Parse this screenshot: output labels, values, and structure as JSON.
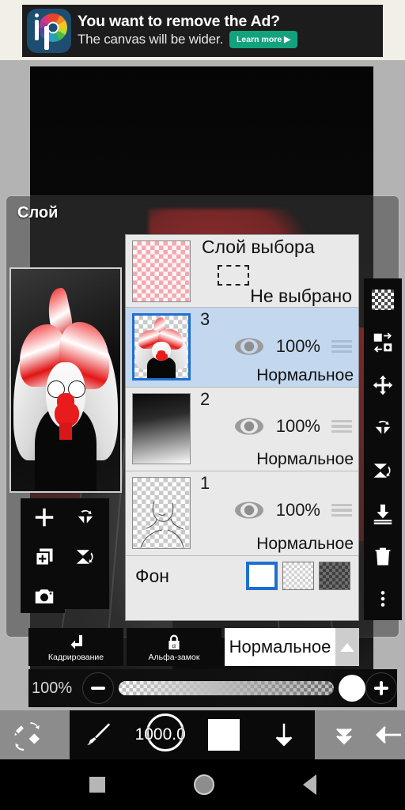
{
  "ad": {
    "headline": "You want to remove the Ad?",
    "subline": "The canvas will be wider.",
    "cta": "Learn more ▶",
    "logo_alt": "ibis Paint X",
    "cta_color": "#12a37d"
  },
  "panel": {
    "title": "Слой",
    "selection_row": {
      "title": "Слой выбора",
      "state": "Не выбрано"
    },
    "layers": [
      {
        "number": "3",
        "opacity": "100%",
        "blend": "Нормальное",
        "selected": true,
        "thumb": "artwork-character"
      },
      {
        "number": "2",
        "opacity": "100%",
        "blend": "Нормальное",
        "selected": false,
        "thumb": "black-white-gradient"
      },
      {
        "number": "1",
        "opacity": "100%",
        "blend": "Нормальное",
        "selected": false,
        "thumb": "sketch-lines"
      }
    ],
    "background": {
      "label": "Фон",
      "swatches": [
        "white",
        "light-checker",
        "dark-checker"
      ],
      "selected_index": 0,
      "selected_color": "#1f6fd0"
    }
  },
  "left_tools": [
    {
      "name": "add-layer-button",
      "icon": "plus-icon"
    },
    {
      "name": "rotate-flip-horizontal-button",
      "icon": "flip-horizontal-rotate-icon"
    },
    {
      "name": "duplicate-layer-button",
      "icon": "copy-plus-icon"
    },
    {
      "name": "rotate-flip-vertical-button",
      "icon": "flip-vertical-rotate-icon"
    },
    {
      "name": "camera-import-button",
      "icon": "camera-icon"
    }
  ],
  "right_tools": [
    {
      "name": "transparency-button",
      "icon": "checkerboard-icon"
    },
    {
      "name": "layer-swap-button",
      "icon": "swap-layers-icon"
    },
    {
      "name": "move-button",
      "icon": "move-arrows-icon"
    },
    {
      "name": "flip-horizontal-button",
      "icon": "flip-horizontal-icon"
    },
    {
      "name": "flip-vertical-button",
      "icon": "flip-vertical-icon"
    },
    {
      "name": "merge-down-button",
      "icon": "merge-down-icon"
    },
    {
      "name": "delete-layer-button",
      "icon": "trash-icon"
    },
    {
      "name": "more-options-button",
      "icon": "vertical-dots-icon"
    }
  ],
  "controls": {
    "crop_label": "Кадрирование",
    "crop_icon": "crop-arrow-icon",
    "alpha_lock_label": "Альфа-замок",
    "alpha_lock_icon": "alpha-lock-icon",
    "blend_mode": "Нормальное",
    "blend_expand_icon": "triangle-up-icon",
    "opacity_value": "100%",
    "minus_icon": "minus-icon",
    "plus_icon": "plus-icon"
  },
  "toolbar": {
    "brush_eraser_icon": "brush-eraser-swap-icon",
    "brush_icon": "brush-icon",
    "brush_size": "1000.0",
    "color_chip": "#ffffff",
    "download_icon": "arrow-down-icon",
    "collapse_icon": "double-chevron-down-icon",
    "back_icon": "arrow-left-icon"
  },
  "navbar": {
    "recents_icon": "square-icon",
    "home_icon": "circle-icon",
    "back_icon": "triangle-back-icon"
  }
}
